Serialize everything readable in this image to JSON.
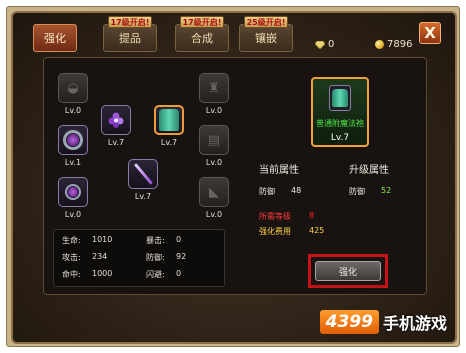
{
  "tabs": [
    {
      "label": "强化",
      "badge": "",
      "active": true
    },
    {
      "label": "提品",
      "badge": "17级开启!",
      "active": false
    },
    {
      "label": "合成",
      "badge": "17级开启!",
      "active": false
    },
    {
      "label": "镶嵌",
      "badge": "25级开启!",
      "active": false
    }
  ],
  "currency": {
    "diamonds": "0",
    "gold": "7896"
  },
  "close_label": "X",
  "slots": [
    {
      "label": "Lv.0"
    },
    {
      "label": "Lv.1"
    },
    {
      "label": "Lv.0"
    },
    {
      "label": "Lv.7"
    },
    {
      "label": "Lv.7"
    },
    {
      "label": "Lv.7"
    },
    {
      "label": "Lv.0"
    },
    {
      "label": "Lv.0"
    },
    {
      "label": "Lv.0"
    }
  ],
  "stats": {
    "hp_label": "生命:",
    "hp": "1010",
    "crit_label": "暴击:",
    "crit": "0",
    "atk_label": "攻击:",
    "atk": "234",
    "def_label": "防御:",
    "def": "92",
    "hit_label": "命中:",
    "hit": "1000",
    "dodge_label": "闪避:",
    "dodge": "0"
  },
  "item": {
    "name": "普通附魔法袍",
    "level": "Lv.7"
  },
  "attrs": {
    "current_title": "当前属性",
    "upgrade_title": "升级属性",
    "current_label": "防御",
    "current_value": "48",
    "upgrade_label": "防御",
    "upgrade_value": "52",
    "req_level_label": "所需等级",
    "req_level": "8",
    "cost_label": "强化费用",
    "cost": "425"
  },
  "upgrade_button": "强化",
  "watermark": {
    "number": "4399",
    "text": "手机游戏"
  },
  "colors": {
    "accent": "#ef9b3a",
    "green": "#8fe85a",
    "red": "#ff2424",
    "yellow": "#ffd24a",
    "highlight": "#c41418"
  }
}
